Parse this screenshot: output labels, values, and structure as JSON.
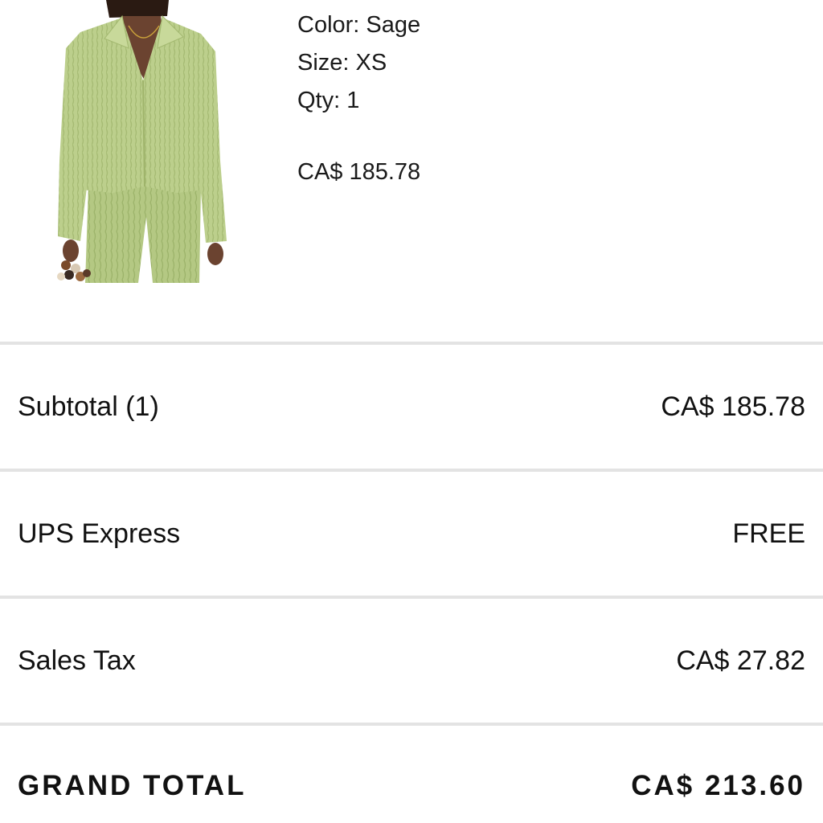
{
  "product": {
    "image_alt": "model wearing sage pleated shirt and pants",
    "color_line": "Color: Sage",
    "size_line": "Size: XS",
    "qty_line": "Qty: 1",
    "price": "CA$ 185.78"
  },
  "summary": {
    "subtotal_label": "Subtotal (1)",
    "subtotal_value": "CA$ 185.78",
    "shipping_label": "UPS Express",
    "shipping_value": "FREE",
    "tax_label": "Sales Tax",
    "tax_value": "CA$ 27.82",
    "grand_total_label": "GRAND TOTAL",
    "grand_total_value": "CA$ 213.60"
  },
  "colors": {
    "garment": "#b9cc8a",
    "divider": "#e3e3e3",
    "text": "#111111"
  }
}
